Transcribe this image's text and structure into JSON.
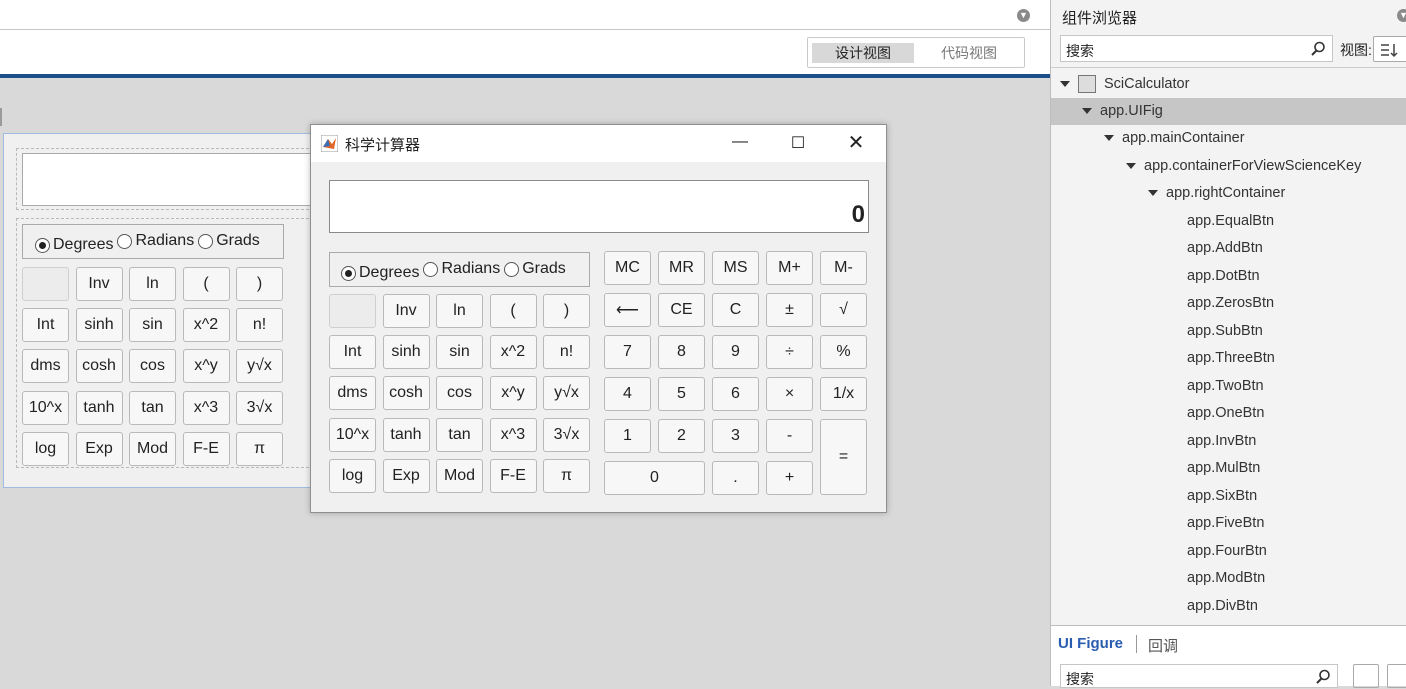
{
  "designer": {
    "view_design": "设计视图",
    "view_code": "代码视图"
  },
  "calculator": {
    "window_title": "科学计算器",
    "display_value": "0",
    "angle_modes": [
      "Degrees",
      "Radians",
      "Grads"
    ],
    "selected_mode": "Degrees",
    "sci_rows": [
      [
        "",
        "Inv",
        "ln",
        "(",
        ")"
      ],
      [
        "Int",
        "sinh",
        "sin",
        "x^2",
        "n!"
      ],
      [
        "dms",
        "cosh",
        "cos",
        "x^y",
        "y√x"
      ],
      [
        "10^x",
        "tanh",
        "tan",
        "x^3",
        "3√x"
      ],
      [
        "log",
        "Exp",
        "Mod",
        "F-E",
        "π"
      ]
    ],
    "memory_keys": [
      "MC",
      "MR",
      "MS",
      "M+",
      "M-"
    ],
    "std_rows": [
      [
        "⟵",
        "CE",
        "C",
        "±",
        "√"
      ],
      [
        "7",
        "8",
        "9",
        "÷",
        "%"
      ],
      [
        "4",
        "5",
        "6",
        "×",
        "1/x"
      ],
      [
        "1",
        "2",
        "3",
        "-",
        "="
      ]
    ],
    "bottom_row": [
      "0",
      ".",
      "+"
    ]
  },
  "component_browser": {
    "title": "组件浏览器",
    "search_placeholder": "搜索",
    "view_label": "视图:",
    "tree": [
      {
        "label": "SciCalculator",
        "level": 0,
        "expanded": true,
        "selected": false
      },
      {
        "label": "app.UIFig",
        "level": 1,
        "expanded": true,
        "selected": true
      },
      {
        "label": "app.mainContainer",
        "level": 2,
        "expanded": true,
        "selected": false
      },
      {
        "label": "app.containerForViewScienceKey",
        "level": 3,
        "expanded": true,
        "selected": false
      },
      {
        "label": "app.rightContainer",
        "level": 4,
        "expanded": true,
        "selected": false
      },
      {
        "label": "app.EqualBtn",
        "level": 5,
        "selected": false
      },
      {
        "label": "app.AddBtn",
        "level": 5,
        "selected": false
      },
      {
        "label": "app.DotBtn",
        "level": 5,
        "selected": false
      },
      {
        "label": "app.ZerosBtn",
        "level": 5,
        "selected": false
      },
      {
        "label": "app.SubBtn",
        "level": 5,
        "selected": false
      },
      {
        "label": "app.ThreeBtn",
        "level": 5,
        "selected": false
      },
      {
        "label": "app.TwoBtn",
        "level": 5,
        "selected": false
      },
      {
        "label": "app.OneBtn",
        "level": 5,
        "selected": false
      },
      {
        "label": "app.InvBtn",
        "level": 5,
        "selected": false
      },
      {
        "label": "app.MulBtn",
        "level": 5,
        "selected": false
      },
      {
        "label": "app.SixBtn",
        "level": 5,
        "selected": false
      },
      {
        "label": "app.FiveBtn",
        "level": 5,
        "selected": false
      },
      {
        "label": "app.FourBtn",
        "level": 5,
        "selected": false
      },
      {
        "label": "app.ModBtn",
        "level": 5,
        "selected": false
      },
      {
        "label": "app.DivBtn",
        "level": 5,
        "selected": false
      }
    ],
    "inspector_tabs": [
      "UI Figure",
      "回调"
    ],
    "inspector_search_placeholder": "搜索"
  }
}
